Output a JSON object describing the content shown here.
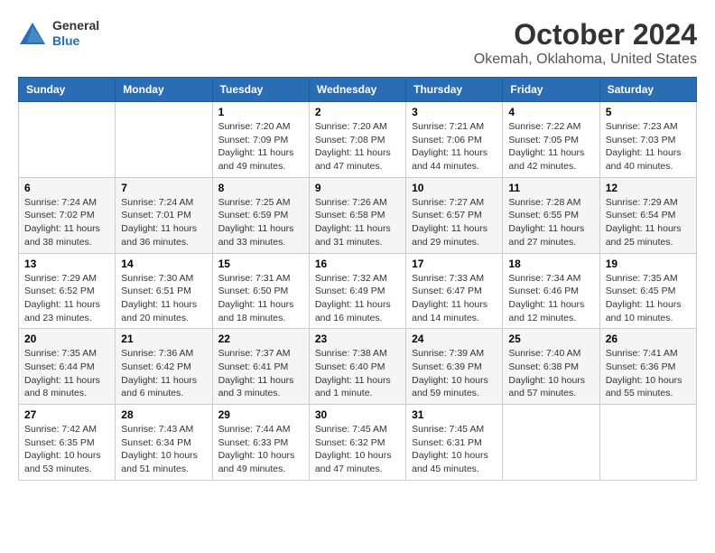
{
  "logo": {
    "general": "General",
    "blue": "Blue"
  },
  "title": "October 2024",
  "subtitle": "Okemah, Oklahoma, United States",
  "headers": [
    "Sunday",
    "Monday",
    "Tuesday",
    "Wednesday",
    "Thursday",
    "Friday",
    "Saturday"
  ],
  "weeks": [
    [
      {
        "day": "",
        "info": ""
      },
      {
        "day": "",
        "info": ""
      },
      {
        "day": "1",
        "info": "Sunrise: 7:20 AM\nSunset: 7:09 PM\nDaylight: 11 hours and 49 minutes."
      },
      {
        "day": "2",
        "info": "Sunrise: 7:20 AM\nSunset: 7:08 PM\nDaylight: 11 hours and 47 minutes."
      },
      {
        "day": "3",
        "info": "Sunrise: 7:21 AM\nSunset: 7:06 PM\nDaylight: 11 hours and 44 minutes."
      },
      {
        "day": "4",
        "info": "Sunrise: 7:22 AM\nSunset: 7:05 PM\nDaylight: 11 hours and 42 minutes."
      },
      {
        "day": "5",
        "info": "Sunrise: 7:23 AM\nSunset: 7:03 PM\nDaylight: 11 hours and 40 minutes."
      }
    ],
    [
      {
        "day": "6",
        "info": "Sunrise: 7:24 AM\nSunset: 7:02 PM\nDaylight: 11 hours and 38 minutes."
      },
      {
        "day": "7",
        "info": "Sunrise: 7:24 AM\nSunset: 7:01 PM\nDaylight: 11 hours and 36 minutes."
      },
      {
        "day": "8",
        "info": "Sunrise: 7:25 AM\nSunset: 6:59 PM\nDaylight: 11 hours and 33 minutes."
      },
      {
        "day": "9",
        "info": "Sunrise: 7:26 AM\nSunset: 6:58 PM\nDaylight: 11 hours and 31 minutes."
      },
      {
        "day": "10",
        "info": "Sunrise: 7:27 AM\nSunset: 6:57 PM\nDaylight: 11 hours and 29 minutes."
      },
      {
        "day": "11",
        "info": "Sunrise: 7:28 AM\nSunset: 6:55 PM\nDaylight: 11 hours and 27 minutes."
      },
      {
        "day": "12",
        "info": "Sunrise: 7:29 AM\nSunset: 6:54 PM\nDaylight: 11 hours and 25 minutes."
      }
    ],
    [
      {
        "day": "13",
        "info": "Sunrise: 7:29 AM\nSunset: 6:52 PM\nDaylight: 11 hours and 23 minutes."
      },
      {
        "day": "14",
        "info": "Sunrise: 7:30 AM\nSunset: 6:51 PM\nDaylight: 11 hours and 20 minutes."
      },
      {
        "day": "15",
        "info": "Sunrise: 7:31 AM\nSunset: 6:50 PM\nDaylight: 11 hours and 18 minutes."
      },
      {
        "day": "16",
        "info": "Sunrise: 7:32 AM\nSunset: 6:49 PM\nDaylight: 11 hours and 16 minutes."
      },
      {
        "day": "17",
        "info": "Sunrise: 7:33 AM\nSunset: 6:47 PM\nDaylight: 11 hours and 14 minutes."
      },
      {
        "day": "18",
        "info": "Sunrise: 7:34 AM\nSunset: 6:46 PM\nDaylight: 11 hours and 12 minutes."
      },
      {
        "day": "19",
        "info": "Sunrise: 7:35 AM\nSunset: 6:45 PM\nDaylight: 11 hours and 10 minutes."
      }
    ],
    [
      {
        "day": "20",
        "info": "Sunrise: 7:35 AM\nSunset: 6:44 PM\nDaylight: 11 hours and 8 minutes."
      },
      {
        "day": "21",
        "info": "Sunrise: 7:36 AM\nSunset: 6:42 PM\nDaylight: 11 hours and 6 minutes."
      },
      {
        "day": "22",
        "info": "Sunrise: 7:37 AM\nSunset: 6:41 PM\nDaylight: 11 hours and 3 minutes."
      },
      {
        "day": "23",
        "info": "Sunrise: 7:38 AM\nSunset: 6:40 PM\nDaylight: 11 hours and 1 minute."
      },
      {
        "day": "24",
        "info": "Sunrise: 7:39 AM\nSunset: 6:39 PM\nDaylight: 10 hours and 59 minutes."
      },
      {
        "day": "25",
        "info": "Sunrise: 7:40 AM\nSunset: 6:38 PM\nDaylight: 10 hours and 57 minutes."
      },
      {
        "day": "26",
        "info": "Sunrise: 7:41 AM\nSunset: 6:36 PM\nDaylight: 10 hours and 55 minutes."
      }
    ],
    [
      {
        "day": "27",
        "info": "Sunrise: 7:42 AM\nSunset: 6:35 PM\nDaylight: 10 hours and 53 minutes."
      },
      {
        "day": "28",
        "info": "Sunrise: 7:43 AM\nSunset: 6:34 PM\nDaylight: 10 hours and 51 minutes."
      },
      {
        "day": "29",
        "info": "Sunrise: 7:44 AM\nSunset: 6:33 PM\nDaylight: 10 hours and 49 minutes."
      },
      {
        "day": "30",
        "info": "Sunrise: 7:45 AM\nSunset: 6:32 PM\nDaylight: 10 hours and 47 minutes."
      },
      {
        "day": "31",
        "info": "Sunrise: 7:45 AM\nSunset: 6:31 PM\nDaylight: 10 hours and 45 minutes."
      },
      {
        "day": "",
        "info": ""
      },
      {
        "day": "",
        "info": ""
      }
    ]
  ]
}
